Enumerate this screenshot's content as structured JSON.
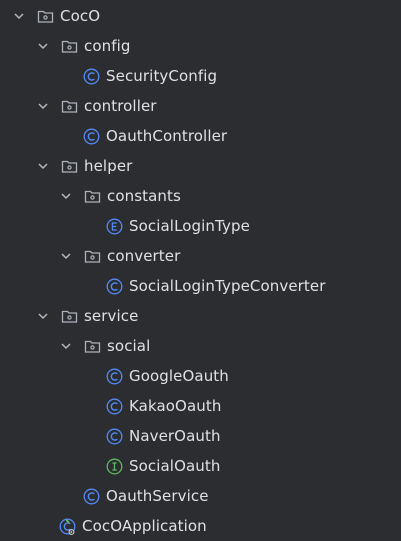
{
  "tree": {
    "items": [
      {
        "label": "CocO",
        "type": "folder",
        "depth": 0,
        "expanded": true
      },
      {
        "label": "config",
        "type": "folder",
        "depth": 1,
        "expanded": true
      },
      {
        "label": "SecurityConfig",
        "type": "class",
        "depth": 2
      },
      {
        "label": "controller",
        "type": "folder",
        "depth": 1,
        "expanded": true
      },
      {
        "label": "OauthController",
        "type": "class",
        "depth": 2
      },
      {
        "label": "helper",
        "type": "folder",
        "depth": 1,
        "expanded": true
      },
      {
        "label": "constants",
        "type": "folder",
        "depth": 2,
        "expanded": true
      },
      {
        "label": "SocialLoginType",
        "type": "enum",
        "depth": 3
      },
      {
        "label": "converter",
        "type": "folder",
        "depth": 2,
        "expanded": true
      },
      {
        "label": "SocialLoginTypeConverter",
        "type": "class",
        "depth": 3
      },
      {
        "label": "service",
        "type": "folder",
        "depth": 1,
        "expanded": true
      },
      {
        "label": "social",
        "type": "folder",
        "depth": 2,
        "expanded": true
      },
      {
        "label": "GoogleOauth",
        "type": "class",
        "depth": 3
      },
      {
        "label": "KakaoOauth",
        "type": "class",
        "depth": 3
      },
      {
        "label": "NaverOauth",
        "type": "class",
        "depth": 3
      },
      {
        "label": "SocialOauth",
        "type": "interface",
        "depth": 3
      },
      {
        "label": "OauthService",
        "type": "class",
        "depth": 2
      },
      {
        "label": "CocOApplication",
        "type": "spring-app",
        "depth": 1
      }
    ]
  },
  "icons": {
    "chevron": "chevron-down-icon",
    "folder": "package-folder-icon",
    "class": "class-icon",
    "enum": "enum-icon",
    "interface": "interface-icon",
    "spring-app": "spring-boot-application-icon"
  },
  "colors": {
    "background": "#2b2d30",
    "text": "#dfe1e5",
    "chevron": "#b4b8bf",
    "folder": "#aeb3bb",
    "class": "#548af7",
    "enum": "#548af7",
    "interface": "#5fb865",
    "spring": "#5fb865"
  }
}
